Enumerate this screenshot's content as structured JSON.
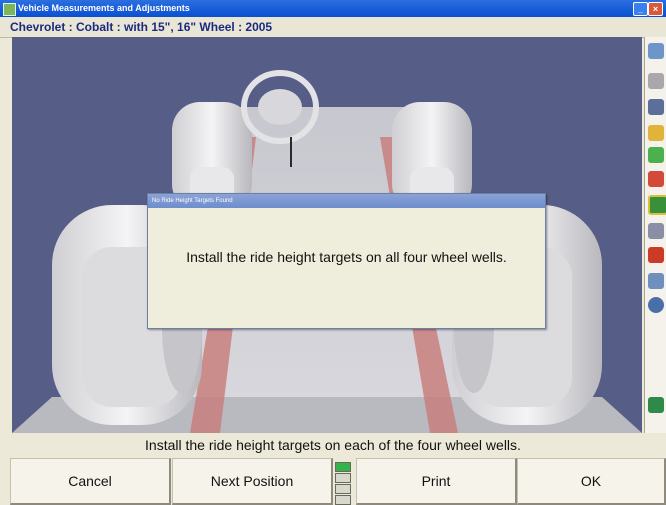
{
  "window": {
    "title": "Vehicle Measurements and Adjustments",
    "minimize_glyph": "_",
    "close_glyph": "×"
  },
  "vehicle": {
    "label": "Chevrolet : Cobalt : with 15\", 16\" Wheel : 2005"
  },
  "viewport": {
    "background_color": "#565d86",
    "scene": "vehicle-chassis-with-steering-wheel"
  },
  "dialog": {
    "title": "No Ride Height Targets Found",
    "message": "Install the ride height targets on all four wheel wells."
  },
  "instruction": {
    "text": "Install the ride height targets on each of the four wheel wells."
  },
  "buttons": {
    "cancel": "Cancel",
    "next_position": "Next Position",
    "print": "Print",
    "ok": "OK"
  },
  "toolbar_icons": [
    "measure-icon",
    "vehicle-icon",
    "lift-icon",
    "wrench-icon",
    "camber-icon",
    "caster-icon",
    "alignment-icon",
    "spec-icon",
    "flag-icon",
    "report-icon",
    "help-icon"
  ],
  "colors": {
    "titlebar": "#0a4fd0",
    "subtitle_text": "#1b2a80",
    "level_green": "#36b24a"
  }
}
